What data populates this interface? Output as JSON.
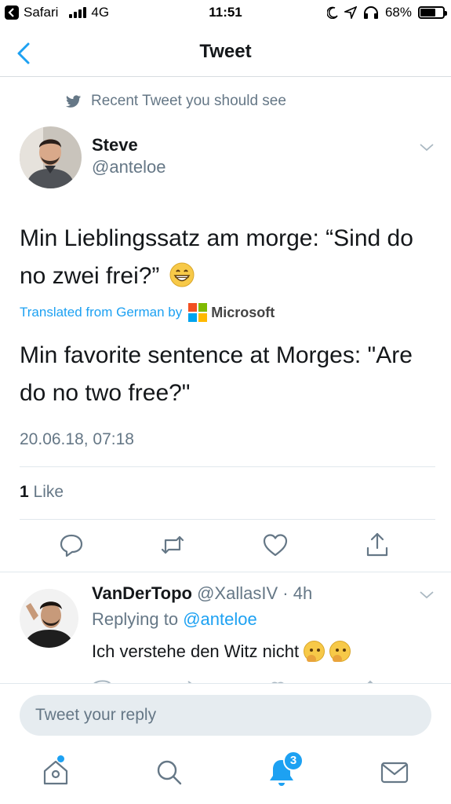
{
  "status_bar": {
    "back_app": "Safari",
    "network": "4G",
    "time": "11:51",
    "battery_percent": "68%",
    "battery_level": 0.68
  },
  "nav": {
    "title": "Tweet",
    "back_icon": "chevron-left-icon"
  },
  "recent_label": "Recent Tweet you should see",
  "tweet": {
    "author_name": "Steve",
    "author_handle": "@anteloe",
    "text": "Min Lieblingssatz am morge: “Sind do no zwei frei?”",
    "emoji": "grinning-face",
    "translated_prefix": "Translated from German by",
    "translator": "Microsoft",
    "translation": "Min favorite sentence at Morges: \"Are do no two free?\"",
    "timestamp": "20.06.18, 07:18",
    "like_count": "1",
    "like_label": "Like"
  },
  "actions": [
    "reply-icon",
    "retweet-icon",
    "heart-icon",
    "share-icon"
  ],
  "reply": {
    "author_name": "VanDerTopo",
    "author_handle": "@XallasIV",
    "separator": "·",
    "age": "4h",
    "replying_prefix": "Replying to",
    "replying_to": "@anteloe",
    "text": "Ich verstehe den Witz nicht",
    "emojis": [
      "thinking-face",
      "thinking-face"
    ]
  },
  "composer": {
    "placeholder": "Tweet your reply"
  },
  "tabbar": {
    "tabs": [
      "home-icon",
      "search-icon",
      "notifications-icon",
      "messages-icon"
    ],
    "notifications_badge": "3"
  },
  "colors": {
    "accent": "#1da1f2",
    "secondary_text": "#657786",
    "divider": "#e1e8ed"
  }
}
